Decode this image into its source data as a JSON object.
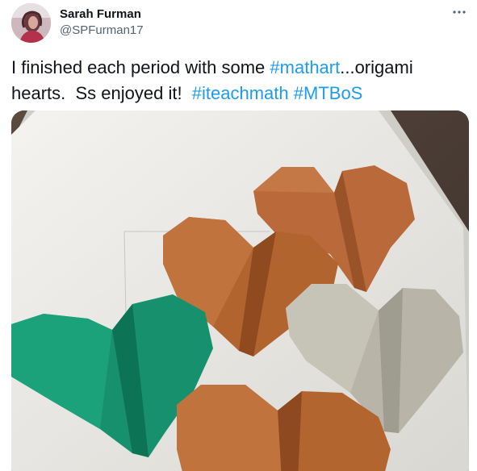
{
  "author": {
    "display_name": "Sarah Furman",
    "handle": "@SPFurman17"
  },
  "menu": {
    "icon": "more-horizontal-icon"
  },
  "tweet": {
    "line1_prefix": "I finished each period with some ",
    "line1_hashtag": "#mathart",
    "line1_suffix": "...origami",
    "line2_prefix": "hearts.  Ss enjoyed it!  ",
    "hashtag_2": "#iteachmath",
    "hashtag_3": "#MTBoS"
  },
  "media": {
    "hearts": [
      {
        "color": "orange-brown"
      },
      {
        "color": "orange-brown"
      },
      {
        "color": "grey"
      },
      {
        "color": "green"
      },
      {
        "color": "orange-brown"
      }
    ]
  },
  "colors": {
    "hashtag": "#1d9bf0",
    "text": "#0f1419",
    "secondary": "#536471",
    "orange_heart": "#b2673a",
    "green_heart": "#18936f",
    "grey_heart": "#b9b6a9"
  }
}
